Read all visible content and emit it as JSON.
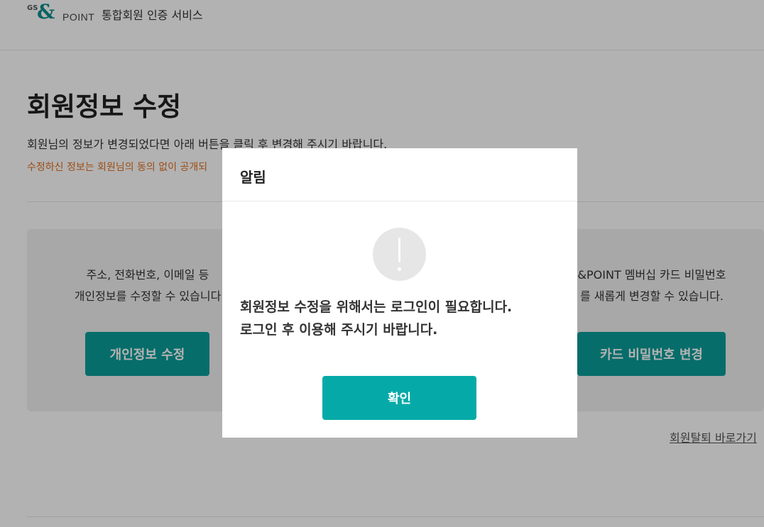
{
  "header": {
    "logo": {
      "gs": "GS",
      "amp": "&",
      "point": "POINT"
    },
    "service_name": "통합회원 인증 서비스"
  },
  "page": {
    "title": "회원정보 수정",
    "description": "회원님의 정보가 변경되었다면 아래 버튼을 클릭 후 변경해 주시기 바랍니다.",
    "notice": "수정하신 정보는 회원님의 동의 없이 공개되"
  },
  "left_card": {
    "line1": "주소, 전화번호, 이메일 등",
    "line2": "개인정보를 수정할 수 있습니다",
    "button": "개인정보 수정"
  },
  "right_card": {
    "line1": "&POINT 멤버십 카드 비밀번호",
    "line2": "를 새롭게 변경할 수 있습니다.",
    "button": "카드 비밀번호 변경"
  },
  "withdraw_link": "회원탈퇴 바로가기",
  "modal": {
    "title": "알림",
    "message_line1": "회원정보 수정을 위해서는 로그인이 필요합니다.",
    "message_line2": "로그인 후 이용해 주시기 바랍니다.",
    "confirm": "확인"
  },
  "colors": {
    "accent": "#05aaa8",
    "button_teal": "#0a9d98",
    "notice": "#e07020"
  },
  "icons": {
    "alert": "exclamation-circle-icon"
  }
}
